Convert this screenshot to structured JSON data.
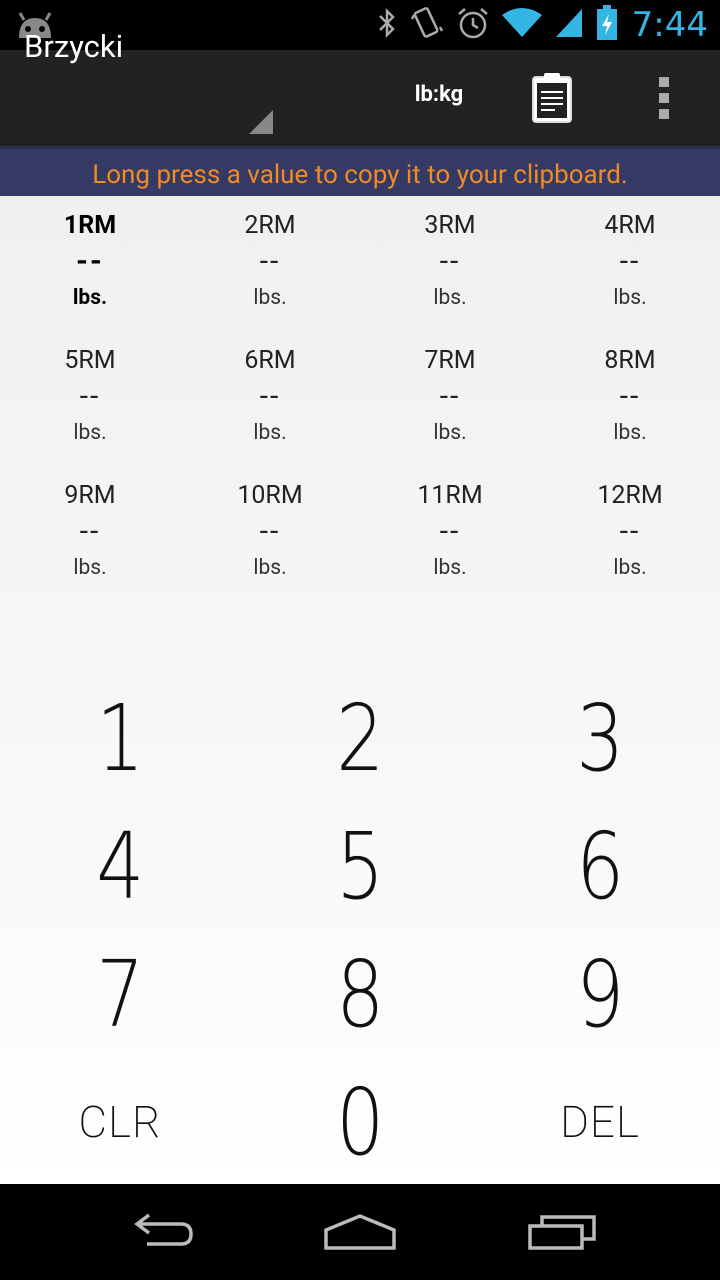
{
  "status_bar": {
    "time": "7:44",
    "icons": [
      "android-icon",
      "bluetooth-icon",
      "vibrate-icon",
      "alarm-icon",
      "wifi-icon",
      "signal-icon",
      "battery-charging-icon"
    ]
  },
  "action_bar": {
    "title": "Brzycki",
    "unit_toggle": "lb:kg",
    "clipboard_icon": "clipboard-icon",
    "overflow_icon": "overflow-menu-icon"
  },
  "hint": "Long press a value to copy it to your clipboard.",
  "rm_values": [
    {
      "label": "1RM",
      "value": "--",
      "unit": "lbs.",
      "active": true
    },
    {
      "label": "2RM",
      "value": "--",
      "unit": "lbs."
    },
    {
      "label": "3RM",
      "value": "--",
      "unit": "lbs."
    },
    {
      "label": "4RM",
      "value": "--",
      "unit": "lbs."
    },
    {
      "label": "5RM",
      "value": "--",
      "unit": "lbs."
    },
    {
      "label": "6RM",
      "value": "--",
      "unit": "lbs."
    },
    {
      "label": "7RM",
      "value": "--",
      "unit": "lbs."
    },
    {
      "label": "8RM",
      "value": "--",
      "unit": "lbs."
    },
    {
      "label": "9RM",
      "value": "--",
      "unit": "lbs."
    },
    {
      "label": "10RM",
      "value": "--",
      "unit": "lbs."
    },
    {
      "label": "11RM",
      "value": "--",
      "unit": "lbs."
    },
    {
      "label": "12RM",
      "value": "--",
      "unit": "lbs."
    }
  ],
  "keypad": [
    "1",
    "2",
    "3",
    "4",
    "5",
    "6",
    "7",
    "8",
    "9",
    "CLR",
    "0",
    "DEL"
  ],
  "nav_bar": [
    "back-icon",
    "home-icon",
    "recent-apps-icon"
  ],
  "colors": {
    "clock": "#33b5e5",
    "hint_bg": "#353a64",
    "hint_text": "#f08a24",
    "action_bar": "#222222"
  }
}
